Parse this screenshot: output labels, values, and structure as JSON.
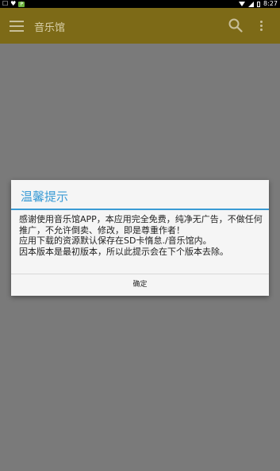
{
  "statusbar": {
    "badge": "P",
    "time": "8:27"
  },
  "appbar": {
    "title": "音乐馆",
    "bg_color": "#7d6a17",
    "search_icon": "search-icon",
    "menu_icon": "hamburger-menu-icon",
    "overflow_icon": "overflow-menu-icon"
  },
  "dialog": {
    "title": "温馨提示",
    "accent_color": "#3a9bd5",
    "lines": [
      "  感谢使用音乐馆APP，本应用完全免费，纯净无广告，不做任何推广，不允许倒卖、修改，即是尊重作者！",
      "  应用下载的资源默认保存在SD卡惰怠./音乐馆内。",
      "  因本版本是最初版本，所以此提示会在下个版本去除。"
    ],
    "button_label": "确定"
  }
}
